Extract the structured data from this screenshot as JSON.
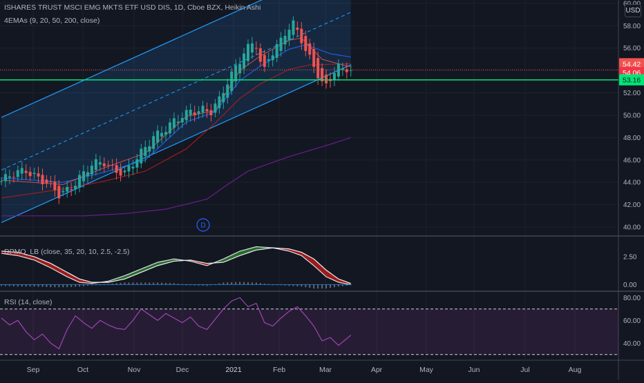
{
  "header": {
    "title": "ISHARES TRUST MSCI EMG MKTS ETF USD DIS, 1D, Cboe BZX, Heikin Ashi",
    "ema_legend": "4EMAs (9, 20, 50, 200, close)",
    "currency_button": "USD"
  },
  "colors": {
    "background": "#131722",
    "grid": "#1e222d",
    "up": "#26a69a",
    "down": "#ef5350",
    "channel": "#2196f3",
    "ema9": "#ef5350",
    "ema20": "#2962ff",
    "ema50": "#b71c1c",
    "ema200": "#7b1fa2",
    "support": "#00e676",
    "rsi": "#ab47bc"
  },
  "chart_data": [
    {
      "type": "candlestick",
      "title": "ISHARES TRUST MSCI EMG MKTS ETF USD DIS, 1D, Cboe BZX, Heikin Ashi",
      "x_ticks": [
        "Sep",
        "Oct",
        "Nov",
        "Dec",
        "2021",
        "Feb",
        "Mar",
        "Apr",
        "May",
        "Jun",
        "Jul",
        "Aug"
      ],
      "y_ticks": [
        "40.00",
        "42.00",
        "44.00",
        "46.00",
        "48.00",
        "50.00",
        "52.00",
        "54.00",
        "56.00",
        "58.00",
        "60.00"
      ],
      "ylim": [
        39.2,
        60.3
      ],
      "close_path": [
        [
          0,
          44.1
        ],
        [
          3,
          44.6
        ],
        [
          6,
          45.2
        ],
        [
          9,
          44.5
        ],
        [
          12,
          43.5
        ],
        [
          14,
          42.8
        ],
        [
          16,
          43.4
        ],
        [
          19,
          44.5
        ],
        [
          22,
          45.4
        ],
        [
          25,
          45.8
        ],
        [
          28,
          45.2
        ],
        [
          30,
          44.8
        ],
        [
          32,
          45.5
        ],
        [
          35,
          47.1
        ],
        [
          37,
          48.3
        ],
        [
          40,
          48.8
        ],
        [
          43,
          49.5
        ],
        [
          46,
          50.5
        ],
        [
          49,
          50.6
        ],
        [
          51,
          50.2
        ],
        [
          53,
          51.2
        ],
        [
          55,
          53.0
        ],
        [
          57,
          54.5
        ],
        [
          59,
          55.7
        ],
        [
          61,
          56.3
        ],
        [
          62,
          56.1
        ],
        [
          63,
          54.5
        ],
        [
          64,
          53.9
        ],
        [
          65,
          55.2
        ],
        [
          67,
          56.3
        ],
        [
          69,
          57.5
        ],
        [
          71,
          58.0
        ],
        [
          72,
          57.4
        ],
        [
          73,
          56.6
        ],
        [
          74,
          55.6
        ],
        [
          76,
          54.6
        ],
        [
          77,
          53.8
        ],
        [
          78,
          53.0
        ],
        [
          79,
          52.7
        ],
        [
          80,
          53.3
        ],
        [
          81,
          53.8
        ],
        [
          82,
          54.1
        ],
        [
          83,
          53.9
        ],
        [
          84,
          54.1
        ],
        [
          85,
          54.06
        ]
      ],
      "ema9": [
        [
          0,
          44.2
        ],
        [
          15,
          43.8
        ],
        [
          25,
          45.3
        ],
        [
          35,
          46.6
        ],
        [
          45,
          49.9
        ],
        [
          52,
          50.4
        ],
        [
          58,
          54.0
        ],
        [
          63,
          55.3
        ],
        [
          70,
          56.7
        ],
        [
          73,
          56.9
        ],
        [
          78,
          55.0
        ],
        [
          85,
          54.3
        ]
      ],
      "ema20": [
        [
          0,
          44.4
        ],
        [
          15,
          44.0
        ],
        [
          25,
          44.9
        ],
        [
          35,
          46.0
        ],
        [
          45,
          49.4
        ],
        [
          52,
          50.3
        ],
        [
          58,
          53.1
        ],
        [
          63,
          54.4
        ],
        [
          70,
          55.9
        ],
        [
          74,
          56.3
        ],
        [
          80,
          55.5
        ],
        [
          85,
          55.2
        ]
      ],
      "ema50": [
        [
          0,
          42.6
        ],
        [
          15,
          43.4
        ],
        [
          25,
          44.1
        ],
        [
          35,
          45.0
        ],
        [
          45,
          47.0
        ],
        [
          52,
          49.3
        ],
        [
          58,
          51.5
        ],
        [
          63,
          52.8
        ],
        [
          70,
          54.1
        ],
        [
          75,
          54.5
        ],
        [
          85,
          54.6
        ]
      ],
      "ema200": [
        [
          0,
          41.0
        ],
        [
          20,
          41.0
        ],
        [
          30,
          41.2
        ],
        [
          40,
          41.6
        ],
        [
          50,
          42.5
        ],
        [
          55,
          43.8
        ],
        [
          60,
          45.0
        ],
        [
          70,
          46.3
        ],
        [
          80,
          47.4
        ],
        [
          85,
          48.0
        ]
      ],
      "channel": {
        "start": [
          0,
          40.4
        ],
        "end": [
          85,
          54.5
        ],
        "width": 9.4
      },
      "support_level": 53.16,
      "price_labels": [
        "54.42",
        "54.06",
        "53.16"
      ],
      "dividend_marker": "D"
    },
    {
      "type": "area",
      "title": "DPMO_LB (close, 35, 20, 10, 2.5, -2.5)",
      "y_ticks": [
        "0.00",
        "2.50"
      ],
      "ylim": [
        -0.6,
        4.3
      ],
      "x": [
        0,
        4,
        8,
        12,
        16,
        19,
        22,
        26,
        30,
        34,
        38,
        42,
        46,
        50,
        54,
        58,
        62,
        66,
        70,
        73,
        76,
        79,
        82,
        85
      ],
      "dpmo": [
        2.8,
        2.6,
        2.2,
        1.5,
        0.7,
        0.2,
        0.1,
        0.3,
        0.8,
        1.4,
        2.0,
        2.3,
        2.1,
        1.7,
        2.3,
        3.0,
        3.4,
        3.3,
        3.0,
        2.6,
        1.7,
        0.7,
        0.2,
        0.0
      ],
      "signal": [
        3.0,
        2.9,
        2.5,
        1.9,
        1.1,
        0.5,
        0.2,
        0.2,
        0.5,
        1.1,
        1.7,
        2.1,
        2.2,
        1.9,
        2.0,
        2.6,
        3.1,
        3.3,
        3.2,
        2.9,
        2.3,
        1.3,
        0.5,
        0.1
      ]
    },
    {
      "type": "line",
      "title": "RSI (14, close)",
      "y_ticks": [
        "40.00",
        "60.00",
        "80.00"
      ],
      "ylim": [
        25,
        85
      ],
      "bands": {
        "upper": 70,
        "lower": 30
      },
      "x": [
        0,
        2,
        4,
        6,
        8,
        10,
        12,
        14,
        16,
        18,
        20,
        22,
        24,
        26,
        28,
        30,
        32,
        34,
        36,
        38,
        40,
        42,
        44,
        46,
        48,
        50,
        52,
        54,
        56,
        58,
        60,
        62,
        64,
        66,
        68,
        70,
        72,
        74,
        76,
        78,
        80,
        82,
        84,
        85
      ],
      "values": [
        62,
        56,
        60,
        50,
        43,
        48,
        40,
        35,
        52,
        64,
        58,
        53,
        60,
        56,
        53,
        52,
        60,
        70,
        65,
        60,
        66,
        62,
        58,
        63,
        55,
        52,
        61,
        70,
        77,
        80,
        72,
        75,
        58,
        55,
        62,
        68,
        72,
        64,
        55,
        42,
        45,
        38,
        44,
        47
      ]
    }
  ]
}
